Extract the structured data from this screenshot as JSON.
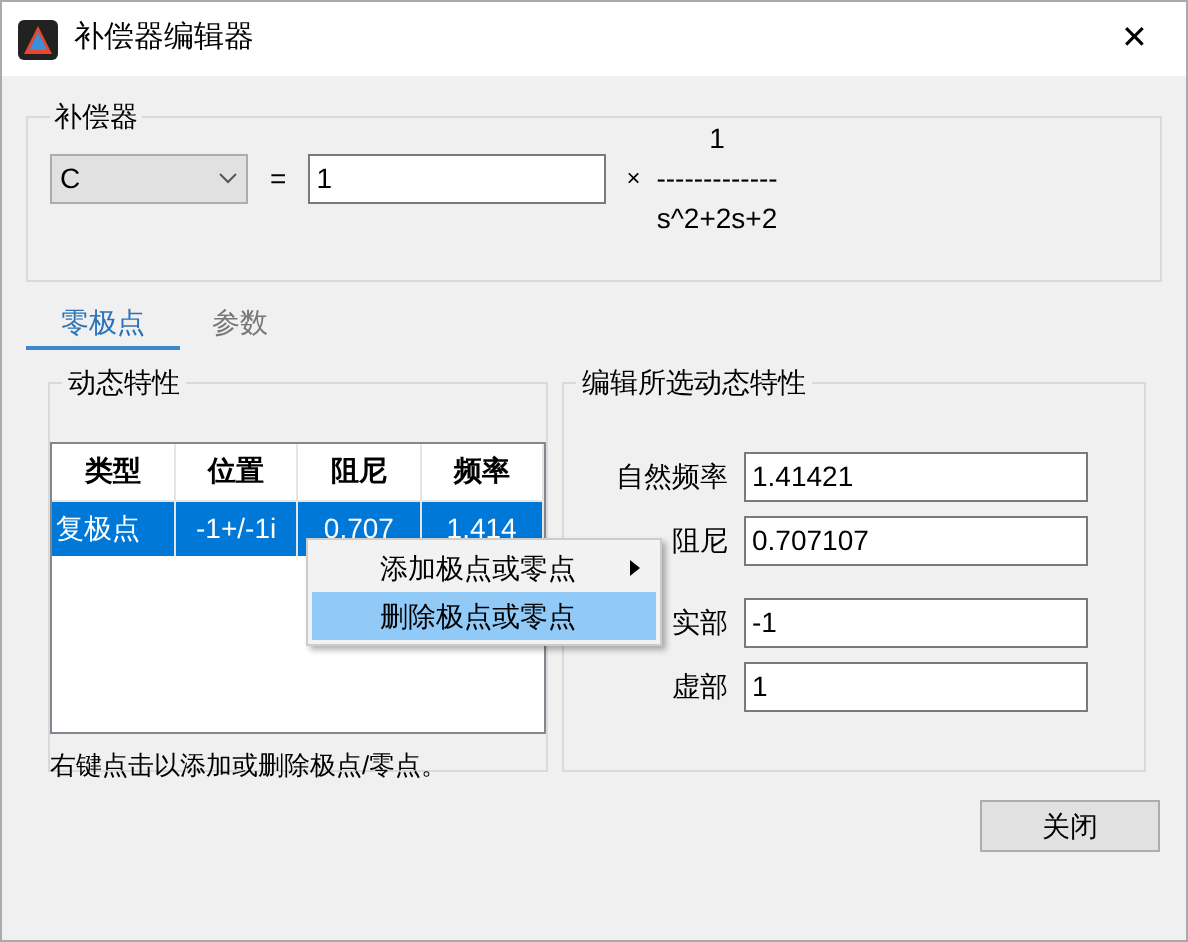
{
  "window": {
    "title": "补偿器编辑器",
    "close": "✕"
  },
  "compensator": {
    "title": "补偿器",
    "selector": "C",
    "equals": "=",
    "gain": "1",
    "times": "×",
    "numerator": "1",
    "fraction_bar": "-------------",
    "denominator": "s^2+2s+2"
  },
  "tabs": [
    {
      "label": "零极点",
      "selected": true
    },
    {
      "label": "参数",
      "selected": false
    }
  ],
  "dynamics": {
    "title": "动态特性",
    "columns": [
      "类型",
      "位置",
      "阻尼",
      "频率"
    ],
    "rows": [
      {
        "cells": [
          "复极点",
          "-1+/-1i",
          "0.707",
          "1.414"
        ],
        "selected": true
      }
    ],
    "hint": "右键点击以添加或删除极点/零点。"
  },
  "context_menu": [
    {
      "label": "添加极点或零点",
      "submenu": true,
      "selected": false
    },
    {
      "label": "删除极点或零点",
      "submenu": false,
      "selected": true
    }
  ],
  "editor": {
    "title": "编辑所选动态特性",
    "fields": [
      {
        "label": "自然频率",
        "value": "1.41421"
      },
      {
        "label": "阻尼",
        "value": "0.707107"
      },
      {
        "label": "实部",
        "value": "-1"
      },
      {
        "label": "虚部",
        "value": "1"
      }
    ]
  },
  "buttons": [
    "关闭"
  ]
}
